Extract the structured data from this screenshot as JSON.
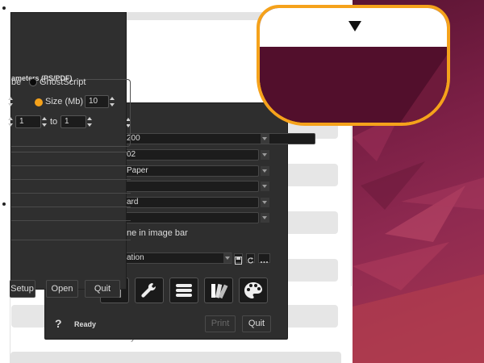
{
  "main": {
    "fields": [
      {
        "value": "200"
      },
      {
        "value": "02"
      },
      {
        "value": "Paper"
      },
      {
        "value": ""
      },
      {
        "value": "ard"
      },
      {
        "value": ""
      }
    ],
    "checkbox_label": "ne in image bar",
    "preset_field": "ation",
    "status": "Ready",
    "help_label": "?",
    "print_label": "Print",
    "quit_label": "Quit"
  },
  "dialog": {
    "group_title": "ameters (PS/PDF)",
    "radio_partial_label": "be",
    "radio_ghostscript_label": "GhostScript",
    "size_label": "Size (Mb)",
    "size_value": "10",
    "range_from": "1",
    "range_to_label": "to",
    "range_to": "1",
    "setup_label": "Setup",
    "open_label": "Open",
    "quit_label": "Quit"
  },
  "background": {
    "text_fragment": "y"
  },
  "colors": {
    "accent_orange": "#f5a21b",
    "dark_panel": "#2e2e2e",
    "wallpaper": "#7a1f45"
  }
}
